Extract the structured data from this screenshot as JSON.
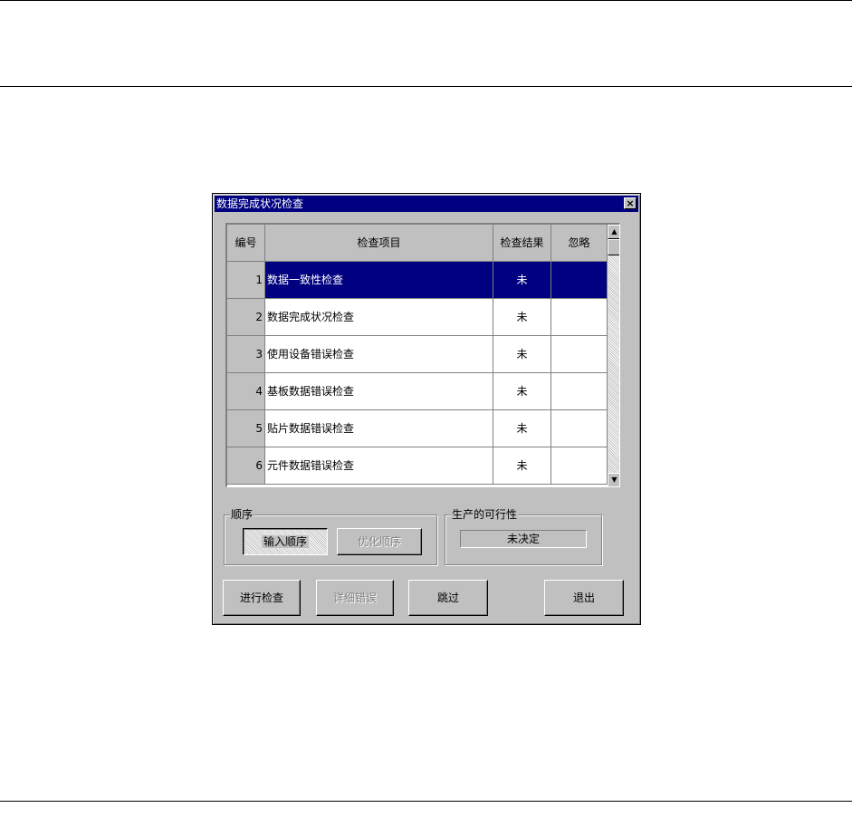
{
  "dialog": {
    "title": "数据完成状况检查",
    "close_label": "×"
  },
  "grid": {
    "headers": [
      "编号",
      "检查项目",
      "检查结果",
      "忽略"
    ],
    "rows": [
      {
        "num": "1",
        "item": "数据一致性检查",
        "result": "未",
        "ignore": "",
        "selected": true
      },
      {
        "num": "2",
        "item": "数据完成状况检查",
        "result": "未",
        "ignore": ""
      },
      {
        "num": "3",
        "item": "使用设备错误检查",
        "result": "未",
        "ignore": ""
      },
      {
        "num": "4",
        "item": "基板数据错误检查",
        "result": "未",
        "ignore": ""
      },
      {
        "num": "5",
        "item": "贴片数据错误检查",
        "result": "未",
        "ignore": ""
      },
      {
        "num": "6",
        "item": "元件数据错误检查",
        "result": "未",
        "ignore": ""
      }
    ],
    "scroll_up_icon": "arrow-up-icon",
    "scroll_down_icon": "arrow-down-icon"
  },
  "order_group": {
    "label": "顺序",
    "input_order_label": "输入顺序",
    "optimize_order_label": "优化顺序"
  },
  "feasibility_group": {
    "label": "生产的可行性",
    "value": "未决定"
  },
  "actions": {
    "check_label": "进行检查",
    "detail_label": "详细错误",
    "skip_label": "跳过",
    "exit_label": "退出"
  },
  "colors": {
    "title_bg": "#000080",
    "face": "#c0c0c0",
    "selection": "#000080"
  }
}
